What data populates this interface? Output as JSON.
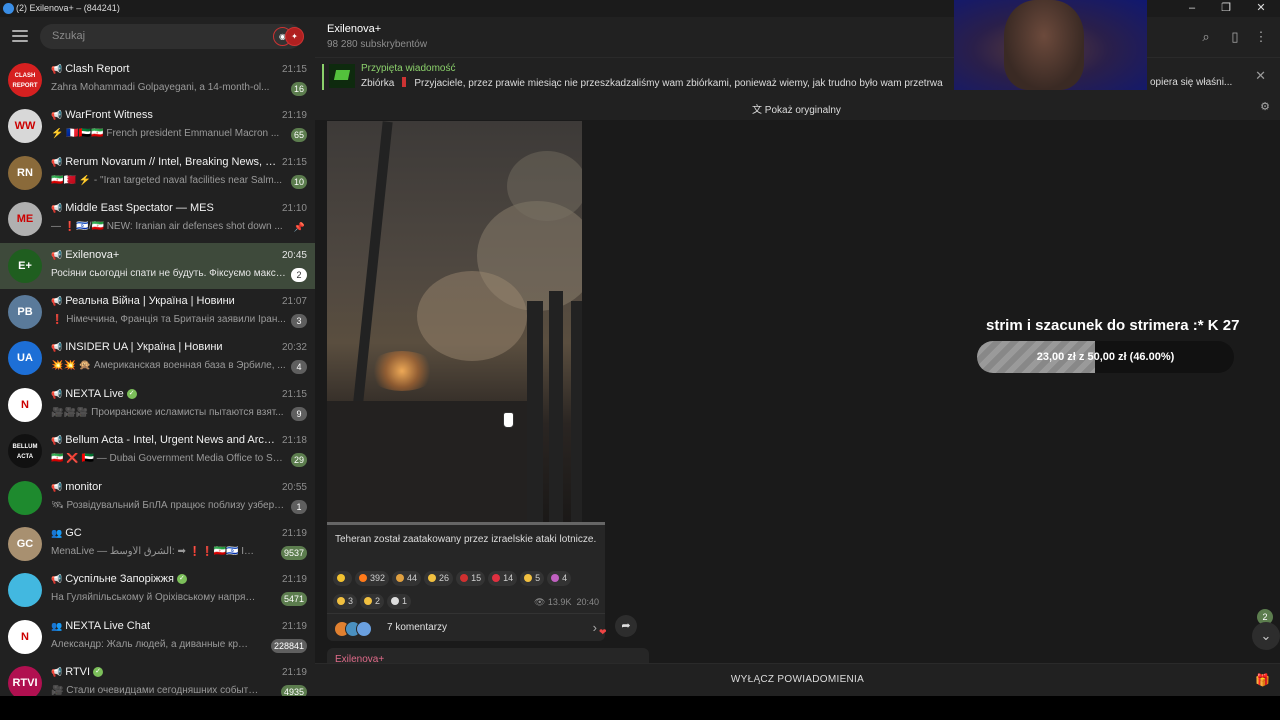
{
  "window": {
    "title": "(2) Exilenova+ – (844241)",
    "controls": [
      "–",
      "❐",
      "✕"
    ]
  },
  "sidebar": {
    "search_placeholder": "Szukaj",
    "chats": [
      {
        "name": "Clash Report",
        "time": "21:15",
        "preview": "Zahra Mohammadi Golpayegani, a 14-month-ol...",
        "badge": "16",
        "avatar_text": "CLASH REPORT",
        "avatar_color": "#d62020",
        "active": false,
        "green": true
      },
      {
        "name": "WarFront Witness",
        "time": "21:19",
        "preview": "⚡ 🇫🇷🇦🇪🇮🇷 French president Emmanuel Macron ...",
        "badge": "65",
        "avatar_text": "WW",
        "avatar_color": "#d8d8d8",
        "active": false,
        "green": true
      },
      {
        "name": "Rerum Novarum // Intel, Breaking News, and ...",
        "time": "21:15",
        "preview": "🇮🇷🇧🇭 ⚡ - \"Iran targeted naval facilities near Salm...",
        "badge": "10",
        "avatar_text": "RN",
        "avatar_color": "#8a6a3a",
        "active": false,
        "green": true
      },
      {
        "name": "Middle East Spectator — MES",
        "time": "21:10",
        "preview": "— ❗🇮🇱/🇮🇷 NEW: Iranian air defenses shot down ...",
        "badge": "",
        "avatar_text": "ME",
        "avatar_color": "#b0b0b0",
        "active": false,
        "green": false,
        "pinned": true
      },
      {
        "name": "Exilenova+",
        "time": "20:45",
        "preview": "Росіяни сьогодні спати не будуть. Фіксуємо макси...",
        "badge": "2",
        "avatar_text": "E+",
        "avatar_color": "#1f5e1f",
        "active": true,
        "green": false
      },
      {
        "name": "Реальна Війна | Україна | Новини",
        "time": "21:07",
        "preview": "❗ Німеччина, Франція та Британія заявили Іран...",
        "badge": "3",
        "avatar_text": "РВ",
        "avatar_color": "#5a7a9a",
        "active": false,
        "green": false
      },
      {
        "name": "INSIDER UA | Україна | Новини",
        "time": "20:32",
        "preview": "💥💥 🙊 Американская военная база в Эрбиле, ...",
        "badge": "4",
        "avatar_text": "UA",
        "avatar_color": "#1d6fd6",
        "active": false,
        "green": false
      },
      {
        "name": "NEXTA Live",
        "time": "21:15",
        "preview": "🎥🎥🎥 Проиранские исламисты пытаются взят...",
        "badge": "9",
        "avatar_text": "N",
        "avatar_color": "#ffffff",
        "active": false,
        "green": false,
        "verified": true
      },
      {
        "name": "Bellum Acta - Intel, Urgent News and Archive...",
        "time": "21:18",
        "preview": "🇮🇷 ❌ 🇦🇪 — Dubai Government Media Office to Sk...",
        "badge": "29",
        "avatar_text": "BELLUM ACTA",
        "avatar_color": "#111111",
        "active": false,
        "green": true
      },
      {
        "name": "monitor",
        "time": "20:55",
        "preview": "🛰 Розвідувальний БпЛА працює поблизу узбере...",
        "badge": "1",
        "avatar_text": "",
        "avatar_color": "#1e8a2e",
        "active": false,
        "green": false
      },
      {
        "name": "GC",
        "time": "21:19",
        "preview": "MenaLive — الشرق الأوسط: ➡ ❗❗🇮🇷🇮🇱 Impact...",
        "badge": "9537",
        "avatar_text": "GC",
        "avatar_color": "#a89070",
        "active": false,
        "green": true,
        "group": true
      },
      {
        "name": "Суспільне Запоріжжя",
        "time": "21:19",
        "preview": "На Гуляйпільському й Оріхівському напрямка...",
        "badge": "5471",
        "avatar_text": "",
        "avatar_color": "#42b8e0",
        "active": false,
        "green": true,
        "verified": true
      },
      {
        "name": "NEXTA Live Chat",
        "time": "21:19",
        "preview": "Александр: Жаль людей, а диванные критик...",
        "badge": "228841",
        "avatar_text": "N",
        "avatar_color": "#ffffff",
        "active": false,
        "green": false,
        "group": true
      },
      {
        "name": "RTVI",
        "time": "21:19",
        "preview": "🎥 Стали очевидцами сегодняшних событий в...",
        "badge": "4935",
        "avatar_text": "RTVI",
        "avatar_color": "#b01050",
        "active": false,
        "green": true,
        "verified": true
      }
    ]
  },
  "header": {
    "channel_name": "Exilenova+",
    "subscribers": "98 280 subskrybentów"
  },
  "pinned": {
    "title": "Przypięta wiadomość",
    "label": "Zbiórka",
    "text": "Przyjaciele, przez prawie miesiąc nie przeszkadzaliśmy wam zbiórkami, ponieważ wiemy, jak trudno było wam przetrwa",
    "text_tail": "opiera się właśni..."
  },
  "translate": {
    "label": "Pokaż oryginalny"
  },
  "message": {
    "caption": "Teheran został zaatakowany przez izraelskie ataki lotnicze.",
    "reactions": [
      {
        "emoji": "⭐",
        "count": "",
        "color": "#f2c230"
      },
      {
        "emoji": "🔥",
        "count": "392",
        "color": "#ff7a1a"
      },
      {
        "emoji": "💥",
        "count": "44",
        "color": "#e0a040"
      },
      {
        "emoji": "👍",
        "count": "26",
        "color": "#f1c040"
      },
      {
        "emoji": "🤬",
        "count": "15",
        "color": "#d03030"
      },
      {
        "emoji": "❤",
        "count": "14",
        "color": "#e03040"
      },
      {
        "emoji": "👏",
        "count": "5",
        "color": "#f1c040"
      },
      {
        "emoji": "💅",
        "count": "4",
        "color": "#c060c0"
      },
      {
        "emoji": "😁",
        "count": "3",
        "color": "#f1c040"
      },
      {
        "emoji": "✍",
        "count": "2",
        "color": "#f1c040"
      },
      {
        "emoji": "🕊",
        "count": "1",
        "color": "#dddddd"
      }
    ],
    "views": "13.9K",
    "time": "20:40",
    "comments": "7 komentarzy"
  },
  "next_message_author": "Exilenova+",
  "footer": {
    "mute_label": "WYŁĄCZ POWIADOMIENIA"
  },
  "scroll": {
    "unread": "2"
  },
  "stream_overlay": {
    "title": "strim i szacunek do strimera :*",
    "count": "27",
    "progress_text": "23,00 zł z 50,00 zł (46.00%)",
    "progress": 0.46
  },
  "icons": {
    "search": "search-icon",
    "sidebar_toggle": "columns-icon",
    "more": "more-vertical-icon"
  },
  "colors": {
    "accent_green": "#8bd16b",
    "active_chat": "#3e4a3b",
    "badge_green": "#5c7d4e"
  }
}
